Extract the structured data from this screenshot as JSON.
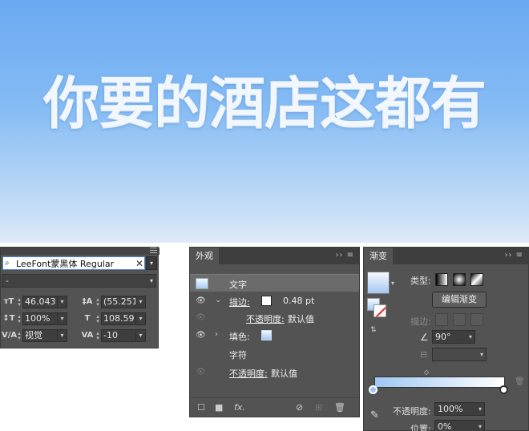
{
  "hero": {
    "title": "你要的酒店这都有"
  },
  "character_panel": {
    "font_name": "LeeFont蒙黑体 Regular",
    "font_style": "-",
    "font_size": "46.043",
    "leading": "(55.251",
    "vertical_scale": "100%",
    "horizontal_scale": "108.59",
    "kerning": "视觉",
    "tracking": "-10"
  },
  "appearance_panel": {
    "tab": "外观",
    "rows": {
      "type_label": "文字",
      "stroke_label": "描边:",
      "stroke_weight": "0.48 pt",
      "stroke_opacity_label": "不透明度:",
      "stroke_opacity_value": "默认值",
      "fill_label": "填色:",
      "characters_label": "字符",
      "opacity_label": "不透明度:",
      "opacity_value": "默认值"
    },
    "footer_fx": "fx."
  },
  "gradient_panel": {
    "tab": "渐变",
    "type_label": "类型:",
    "edit_button": "编辑渐变",
    "stroke_label": "描边:",
    "angle": "90°",
    "opacity_label": "不透明度:",
    "opacity_value": "100%",
    "location_label": "位置:",
    "location_value": "0%"
  },
  "colors": {
    "sky_top": "#6aa9f2",
    "sky_bottom": "#dfeaf8",
    "panel_bg": "#535353",
    "gradient_start": "#9fc7f3",
    "gradient_end": "#ffffff",
    "selection": "#4b87d6"
  },
  "icons": [
    "search-icon",
    "eye-icon",
    "chevron-icon",
    "menu-icon",
    "trash-icon",
    "eyedropper-icon",
    "delete-icon",
    "new-icon",
    "duplicate-icon"
  ]
}
